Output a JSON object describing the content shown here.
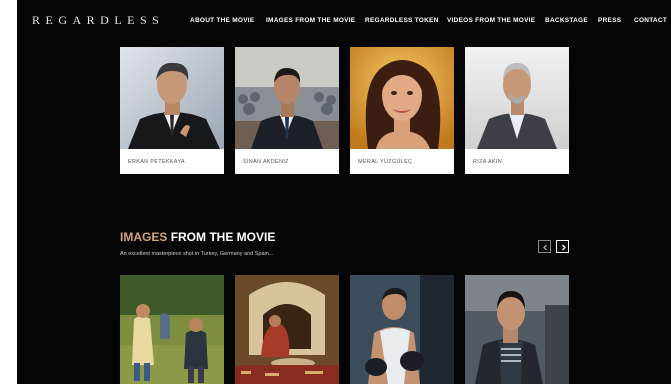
{
  "brand": {
    "logo_text": "REGARDLESS"
  },
  "nav": {
    "items": [
      {
        "label": "ABOUT THE MOVIE"
      },
      {
        "label": "IMAGES FROM THE MOVIE"
      },
      {
        "label": "REGARDLESS TOKEN"
      },
      {
        "label": "VIDEOS FROM THE MOVIE"
      },
      {
        "label": "BACKSTAGE"
      },
      {
        "label": "PRESS"
      },
      {
        "label": "CONTACT"
      }
    ]
  },
  "cast": [
    {
      "name": "ERKAN PETEKKAYA"
    },
    {
      "name": "SİNAN AKDENİZ"
    },
    {
      "name": "MERAL YÜZGÜLEÇ"
    },
    {
      "name": "RIZA AKIN"
    }
  ],
  "images_section": {
    "title_accent": "IMAGES",
    "title_rest": "FROM THE MOVIE",
    "subtitle": "An excellent masterpiece shot in Turkey, Germany and Spain...",
    "prev_icon": "chevron-left-icon",
    "next_icon": "chevron-right-icon"
  },
  "colors": {
    "background": "#050505",
    "accent": "#d4a37c",
    "nav_text": "#ffffff"
  }
}
